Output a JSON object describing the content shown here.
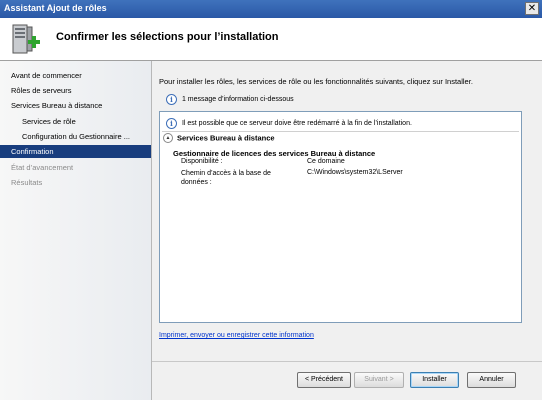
{
  "window": {
    "title": "Assistant Ajout de rôles",
    "close_glyph": "✕"
  },
  "header": {
    "title": "Confirmer les sélections pour l’installation",
    "icon": "server-add-icon"
  },
  "sidebar": {
    "items": [
      {
        "label": "Avant de commencer",
        "state": "normal",
        "level": 0
      },
      {
        "label": "Rôles de serveurs",
        "state": "normal",
        "level": 0
      },
      {
        "label": "Services Bureau à distance",
        "state": "normal",
        "level": 0
      },
      {
        "label": "Services de rôle",
        "state": "normal",
        "level": 1
      },
      {
        "label": "Configuration du Gestionnaire ...",
        "state": "normal",
        "level": 1
      },
      {
        "label": "Confirmation",
        "state": "active",
        "level": 0
      },
      {
        "label": "État d’avancement",
        "state": "disabled",
        "level": 0
      },
      {
        "label": "Résultats",
        "state": "disabled",
        "level": 0
      }
    ]
  },
  "main": {
    "instruction": "Pour installer les rôles, les services de rôle ou les fonctionnalités suivants, cliquez sur Installer.",
    "info_count": "1 message d’information ci-dessous",
    "panel": {
      "warning": "Il est possible que ce serveur doive être redémarré à la fin de l’installation.",
      "section_title": "Services Bureau à distance",
      "subsection_title": "Gestionnaire de licences des services Bureau à distance",
      "rows": [
        {
          "label": "Disponibilité :",
          "value": "Ce domaine"
        },
        {
          "label": "Chemin d’accès à la base de données :",
          "value": "C:\\Windows\\system32\\LServer"
        }
      ]
    },
    "link": "Imprimer, envoyer ou enregistrer cette information"
  },
  "buttons": {
    "previous": "< Précédent",
    "next": "Suivant >",
    "install": "Installer",
    "cancel": "Annuler"
  }
}
